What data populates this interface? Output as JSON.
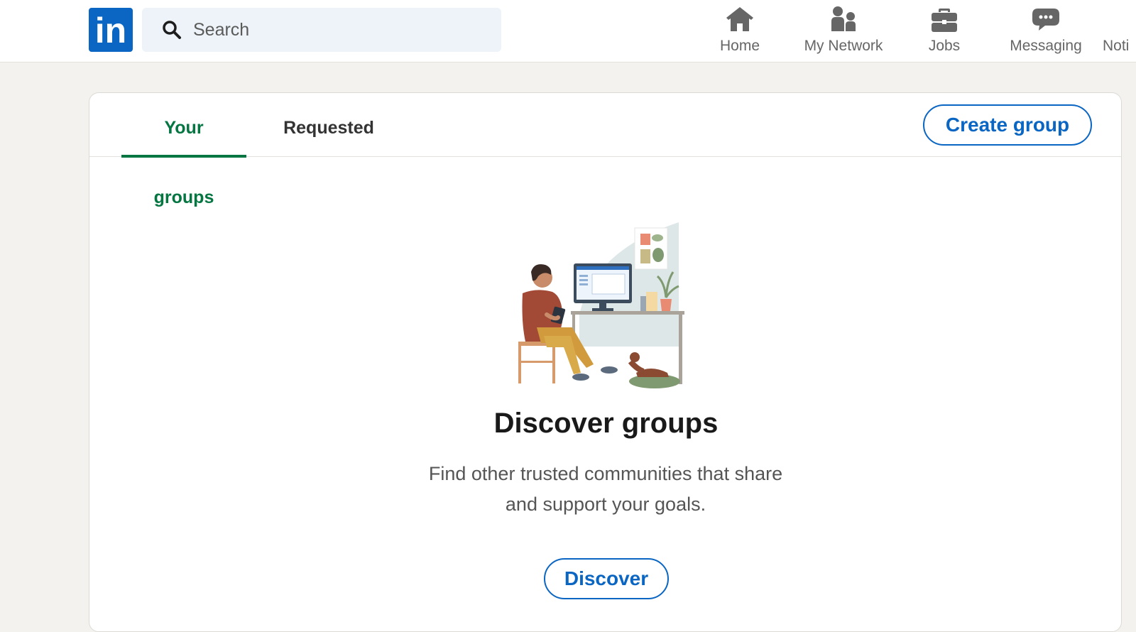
{
  "topbar": {
    "logo_text": "in",
    "search": {
      "placeholder": "Search",
      "icon": "search-icon"
    },
    "nav": [
      {
        "label": "Home",
        "icon": "home-icon"
      },
      {
        "label": "My Network",
        "icon": "people-icon"
      },
      {
        "label": "Jobs",
        "icon": "briefcase-icon"
      },
      {
        "label": "Messaging",
        "icon": "chat-icon"
      },
      {
        "label": "Noti",
        "icon": "bell-icon"
      }
    ]
  },
  "groups": {
    "tabs": [
      {
        "label": "Your groups",
        "active": true
      },
      {
        "label": "Requested",
        "active": false
      }
    ],
    "create_label": "Create group",
    "empty": {
      "title": "Discover groups",
      "line1": "Find other trusted communities that share",
      "line2": "and support your goals.",
      "button_label": "Discover"
    }
  },
  "colors": {
    "brand_blue": "#0a66c2",
    "active_green": "#057642",
    "page_bg": "#f4f2ee",
    "nav_gray": "#666666"
  }
}
